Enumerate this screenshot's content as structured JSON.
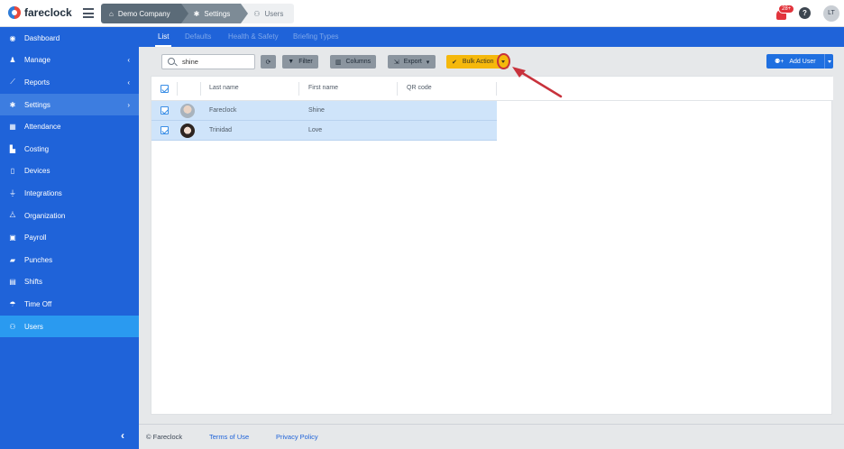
{
  "app": {
    "brand": "fareclock"
  },
  "breadcrumb": [
    "Demo Company",
    "Settings",
    "Users"
  ],
  "header": {
    "notifications": "28+",
    "help": "?",
    "avatar": "LT"
  },
  "sidebar": {
    "items": [
      {
        "label": "Dashboard",
        "icon": "dashboard-icon",
        "glyph": "◉",
        "chevron": ""
      },
      {
        "label": "Manage",
        "icon": "person-icon",
        "glyph": "♟",
        "chevron": "‹"
      },
      {
        "label": "Reports",
        "icon": "chart-icon",
        "glyph": "⟋",
        "chevron": "‹"
      },
      {
        "label": "Settings",
        "icon": "gear-icon",
        "glyph": "✱",
        "chevron": "›"
      },
      {
        "label": "Attendance",
        "icon": "attendance-icon",
        "glyph": "▦",
        "chevron": ""
      },
      {
        "label": "Costing",
        "icon": "costing-icon",
        "glyph": "▙",
        "chevron": ""
      },
      {
        "label": "Devices",
        "icon": "device-icon",
        "glyph": "▯",
        "chevron": ""
      },
      {
        "label": "Integrations",
        "icon": "plug-icon",
        "glyph": "⏚",
        "chevron": ""
      },
      {
        "label": "Organization",
        "icon": "organization-icon",
        "glyph": "⧊",
        "chevron": ""
      },
      {
        "label": "Payroll",
        "icon": "money-icon",
        "glyph": "▣",
        "chevron": ""
      },
      {
        "label": "Punches",
        "icon": "truck-icon",
        "glyph": "▰",
        "chevron": ""
      },
      {
        "label": "Shifts",
        "icon": "calendar-icon",
        "glyph": "▤",
        "chevron": ""
      },
      {
        "label": "Time Off",
        "icon": "umbrella-icon",
        "glyph": "☂",
        "chevron": ""
      },
      {
        "label": "Users",
        "icon": "users-icon",
        "glyph": "⚇",
        "chevron": ""
      }
    ],
    "collapse": "‹"
  },
  "tabs": [
    "List",
    "Defaults",
    "Health & Safety",
    "Briefing Types"
  ],
  "toolbar": {
    "search_value": "shine",
    "filter": "Filter",
    "columns": "Columns",
    "export": "Export",
    "bulk_action": "Bulk Action",
    "add_user": "Add User"
  },
  "table": {
    "columns": [
      "Last name",
      "First name",
      "QR code"
    ],
    "rows": [
      {
        "last": "Fareclock",
        "first": "Shine"
      },
      {
        "last": "Trinidad",
        "first": "Love"
      }
    ]
  },
  "footer": {
    "copyright": "© Fareclock",
    "terms": "Terms of Use",
    "privacy": "Privacy Policy"
  },
  "colors": {
    "sidebar": "#1f63d9",
    "active": "#2a9af0",
    "bulk": "#f5b80c",
    "annotation": "#c8323c"
  }
}
